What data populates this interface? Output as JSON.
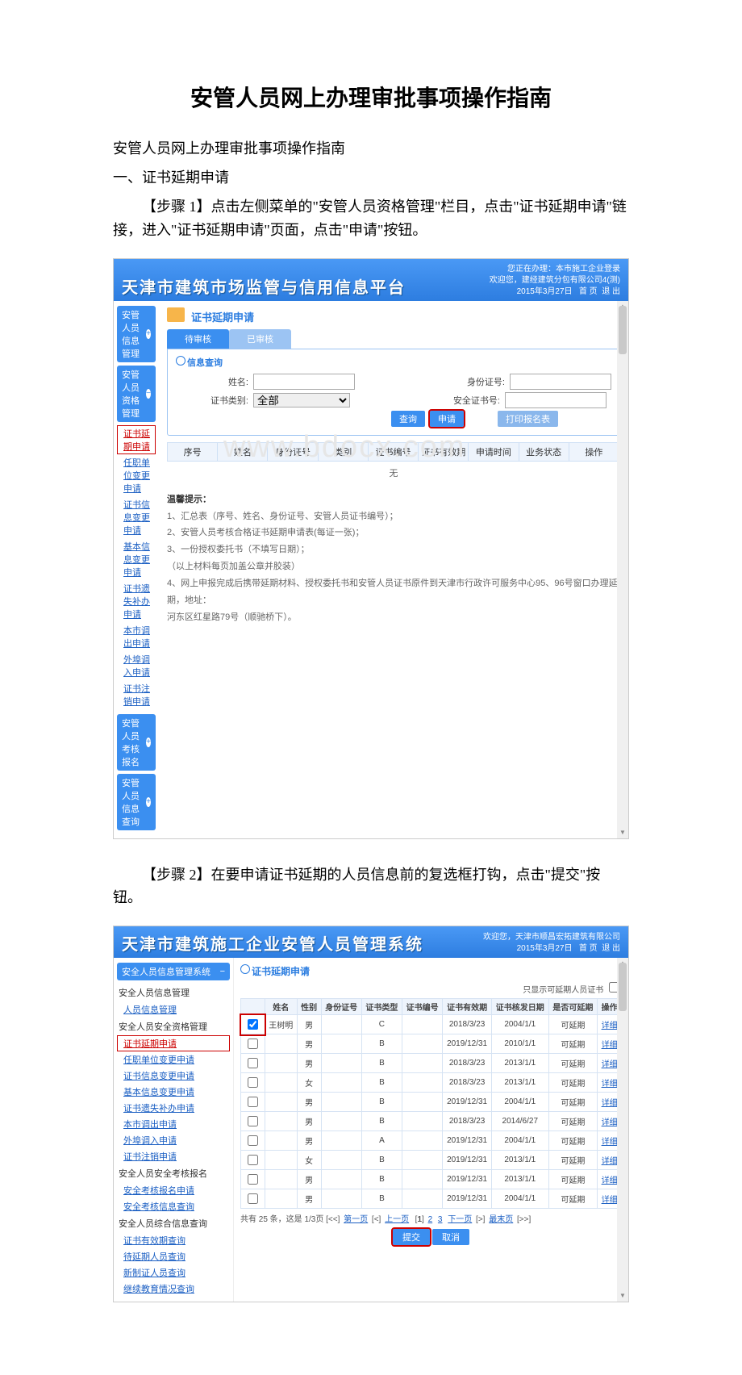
{
  "doc": {
    "title": "安管人员网上办理审批事项操作指南",
    "subtitle": "安管人员网上办理审批事项操作指南",
    "section1": "一、证书延期申请",
    "para1": "【步骤 1】点击左侧菜单的\"安管人员资格管理\"栏目，点击\"证书延期申请\"链接，进入\"证书延期申请\"页面，点击\"申请\"按钮。",
    "para2": "【步骤 2】在要申请证书延期的人员信息前的复选框打钩，点击\"提交\"按钮。"
  },
  "ss1": {
    "platform_title": "天津市建筑市场监管与信用信息平台",
    "topright_line0": "您正在办理：本市施工企业登录",
    "topright_line1": "欢迎您，建经建筑分包有限公司4(测)",
    "topright_date": "2015年3月27日",
    "topright_home": "首 页",
    "topright_exit": "退 出",
    "nav": {
      "h1": "安管人员信息管理",
      "h2": "安管人员资格管理",
      "links": [
        "证书延期申请",
        "任职单位变更申请",
        "证书信息变更申请",
        "基本信息变更申请",
        "证书遗失补办申请",
        "本市调出申请",
        "外埠调入申请",
        "证书注销申请"
      ],
      "h3": "安管人员考核报名",
      "h4": "安管人员信息查询"
    },
    "page_title": "证书延期申请",
    "tab_pending": "待审核",
    "tab_done": "已审核",
    "box_title": "信息查询",
    "form": {
      "name_label": "姓名:",
      "type_label": "证书类别:",
      "type_value": "全部",
      "id_label": "身份证号:",
      "cert_label": "安全证书号:",
      "btn_query": "查询",
      "btn_apply": "申请",
      "btn_print": "打印报名表"
    },
    "thead": [
      "序号",
      "姓名",
      "身份证号",
      "类别",
      "证书编号",
      "证书有效期",
      "申请时间",
      "业务状态",
      "操作"
    ],
    "empty": "无",
    "hint_label": "温馨提示：",
    "hints": [
      "1、汇总表（序号、姓名、身份证号、安管人员证书编号）；",
      "2、安管人员考核合格证书延期申请表(每证一张)；",
      "3、一份授权委托书（不填写日期）；",
      "（以上材料每页加盖公章并胶装）",
      "4、网上申报完成后携带延期材料、授权委托书和安管人员证书原件到天津市行政许可服务中心95、96号窗口办理延期，地址：",
      "河东区红星路79号（顺驰桥下）。"
    ],
    "watermark": "www.bdocx.com"
  },
  "ss2": {
    "platform_title": "天津市建筑施工企业安管人员管理系统",
    "topright_line1": "欢迎您，天津市顺昌宏拓建筑有限公司",
    "topright_date": "2015年3月27日",
    "topright_home": "首 页",
    "topright_exit": "退 出",
    "nav": {
      "h1": "安全人员信息管理系统",
      "cat1": "安全人员信息管理",
      "l1": "人员信息管理",
      "cat2": "安全人员安全资格管理",
      "links2": [
        "证书延期申请",
        "任职单位变更申请",
        "证书信息变更申请",
        "基本信息变更申请",
        "证书遗失补办申请",
        "本市调出申请",
        "外埠调入申请",
        "证书注销申请"
      ],
      "cat3": "安全人员安全考核报名",
      "links3": [
        "安全考核报名申请",
        "安全考核信息查询"
      ],
      "cat4": "安全人员综合信息查询",
      "links4": [
        "证书有效期查询",
        "待延期人员查询",
        "新制证人员查询",
        "继续教育情况查询"
      ]
    },
    "page_title": "证书延期申请",
    "right_note": "只显示可延期人员证书",
    "thead": [
      "",
      "姓名",
      "性别",
      "身份证号",
      "证书类型",
      "证书编号",
      "证书有效期",
      "证书核发日期",
      "是否可延期",
      "操作"
    ],
    "rows": [
      {
        "chk": true,
        "name": "王树明",
        "sex": "男",
        "id": "",
        "type": "C",
        "cert": "",
        "exp": "2018/3/23",
        "issue": "2004/1/1",
        "can": "可延期"
      },
      {
        "chk": false,
        "name": "",
        "sex": "男",
        "id": "",
        "type": "B",
        "cert": "",
        "exp": "2019/12/31",
        "issue": "2010/1/1",
        "can": "可延期"
      },
      {
        "chk": false,
        "name": "",
        "sex": "男",
        "id": "",
        "type": "B",
        "cert": "",
        "exp": "2018/3/23",
        "issue": "2013/1/1",
        "can": "可延期"
      },
      {
        "chk": false,
        "name": "",
        "sex": "女",
        "id": "",
        "type": "B",
        "cert": "",
        "exp": "2018/3/23",
        "issue": "2013/1/1",
        "can": "可延期"
      },
      {
        "chk": false,
        "name": "",
        "sex": "男",
        "id": "",
        "type": "B",
        "cert": "",
        "exp": "2019/12/31",
        "issue": "2004/1/1",
        "can": "可延期"
      },
      {
        "chk": false,
        "name": "",
        "sex": "男",
        "id": "",
        "type": "B",
        "cert": "",
        "exp": "2018/3/23",
        "issue": "2014/6/27",
        "can": "可延期"
      },
      {
        "chk": false,
        "name": "",
        "sex": "男",
        "id": "",
        "type": "A",
        "cert": "",
        "exp": "2019/12/31",
        "issue": "2004/1/1",
        "can": "可延期"
      },
      {
        "chk": false,
        "name": "",
        "sex": "女",
        "id": "",
        "type": "B",
        "cert": "",
        "exp": "2019/12/31",
        "issue": "2013/1/1",
        "can": "可延期"
      },
      {
        "chk": false,
        "name": "",
        "sex": "男",
        "id": "",
        "type": "B",
        "cert": "",
        "exp": "2019/12/31",
        "issue": "2013/1/1",
        "can": "可延期"
      },
      {
        "chk": false,
        "name": "",
        "sex": "男",
        "id": "",
        "type": "B",
        "cert": "",
        "exp": "2019/12/31",
        "issue": "2004/1/1",
        "can": "可延期"
      }
    ],
    "detail_label": "详细",
    "pager": {
      "summary": "共有 25 条，这是 1/3页",
      "first": "第一页",
      "prev": "上一页",
      "p1": "1",
      "p2": "2",
      "p3": "3",
      "next": "下一页",
      "last": "最末页"
    },
    "btn_submit": "提交",
    "btn_cancel": "取消"
  }
}
